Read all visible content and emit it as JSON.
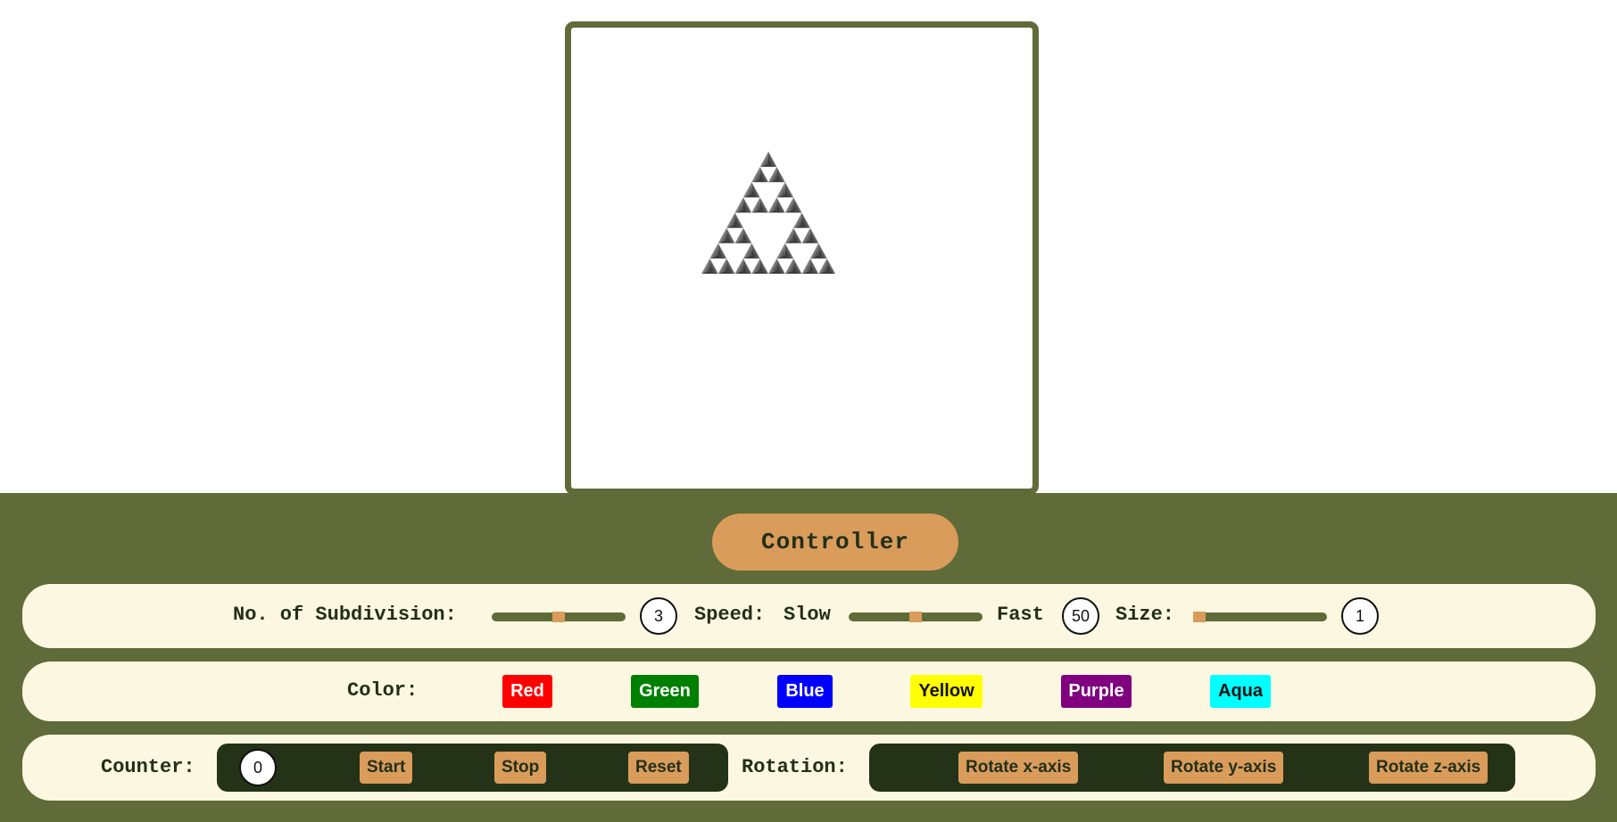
{
  "controller": {
    "label": "Controller"
  },
  "subdivision": {
    "label": "No. of Subdivision:",
    "value": "3",
    "slider_fraction": 0.5
  },
  "speed": {
    "label": "Speed:",
    "slow_label": "Slow",
    "fast_label": "Fast",
    "value": "50",
    "slider_fraction": 0.5
  },
  "size": {
    "label": "Size:",
    "value": "1",
    "slider_fraction": 0.0
  },
  "color": {
    "label": "Color:",
    "buttons": [
      {
        "label": "Red",
        "bg": "#ff0000",
        "fg": "#ffffff"
      },
      {
        "label": "Green",
        "bg": "#008000",
        "fg": "#ffffff"
      },
      {
        "label": "Blue",
        "bg": "#0000ff",
        "fg": "#ffffff"
      },
      {
        "label": "Yellow",
        "bg": "#ffff00",
        "fg": "#111111"
      },
      {
        "label": "Purple",
        "bg": "#800080",
        "fg": "#ffffff"
      },
      {
        "label": "Aqua",
        "bg": "#00ffff",
        "fg": "#111111"
      }
    ]
  },
  "counter": {
    "label": "Counter:",
    "value": "0",
    "start_label": "Start",
    "stop_label": "Stop",
    "reset_label": "Reset"
  },
  "rotation": {
    "label": "Rotation:",
    "x_label": "Rotate x-axis",
    "y_label": "Rotate y-axis",
    "z_label": "Rotate z-axis"
  },
  "theme": {
    "panel": "#5f6b38",
    "accent": "#d99c5a",
    "row_bg": "#fcf7e0",
    "dark": "#243217"
  }
}
